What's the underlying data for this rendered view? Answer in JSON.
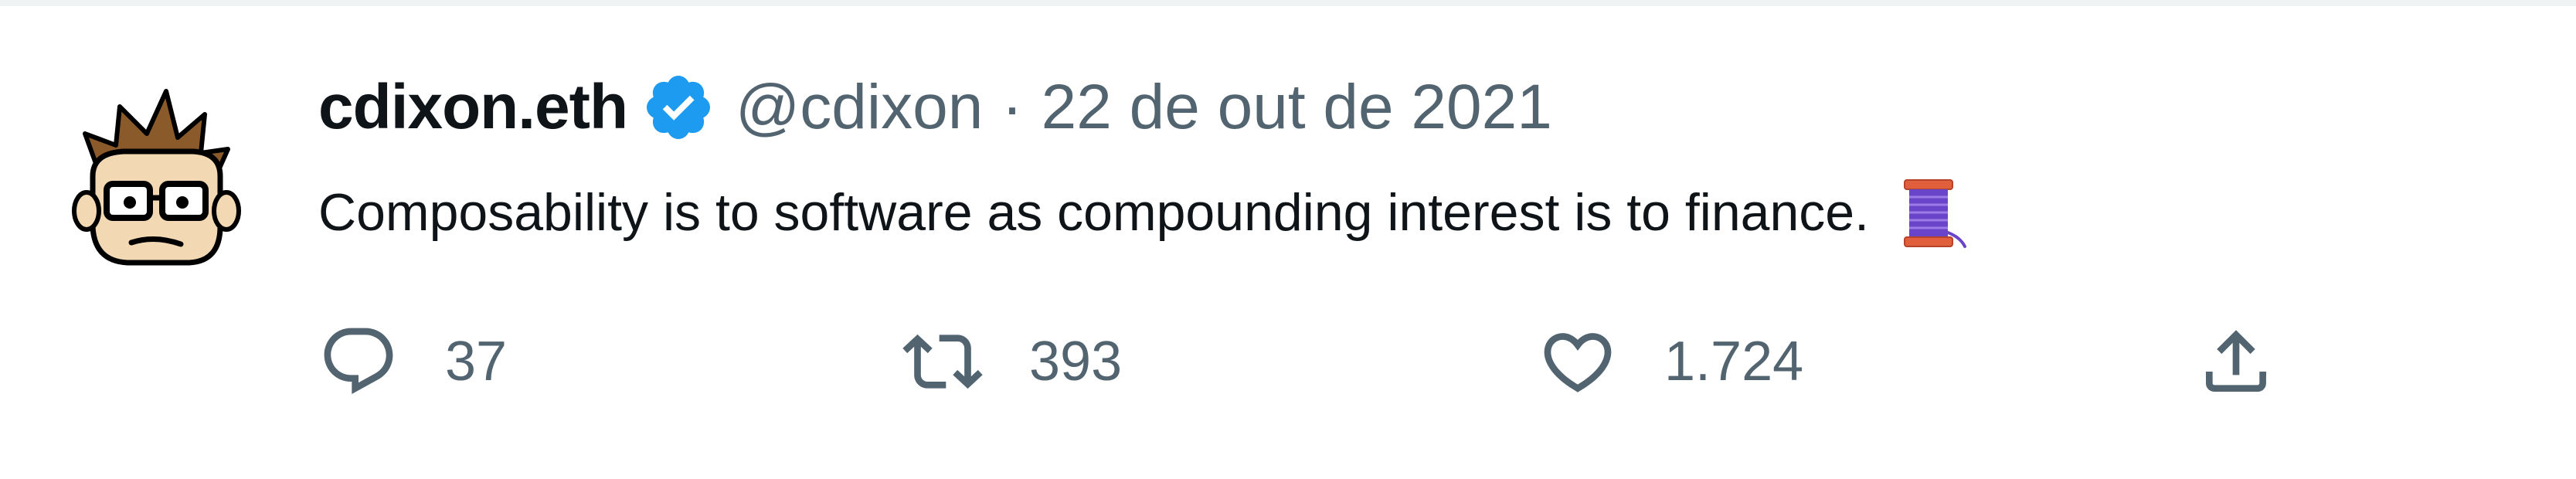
{
  "tweet": {
    "author_name": "cdixon.eth",
    "handle": "@cdixon",
    "separator": "·",
    "date": "22 de out de 2021",
    "text": "Composability is to software as compounding interest is to finance.",
    "emoji_icon": "thread-spool-icon",
    "verified_icon": "verified-badge-icon",
    "avatar_icon": "cartoon-avatar-icon"
  },
  "actions": {
    "reply": {
      "icon": "reply-icon",
      "count": "37"
    },
    "retweet": {
      "icon": "retweet-icon",
      "count": "393"
    },
    "like": {
      "icon": "heart-icon",
      "count": "1.724"
    },
    "share": {
      "icon": "share-icon"
    }
  },
  "colors": {
    "text_primary": "#0f1419",
    "text_secondary": "#536471",
    "verified_blue": "#1d9bf0",
    "divider": "#eff3f4"
  }
}
